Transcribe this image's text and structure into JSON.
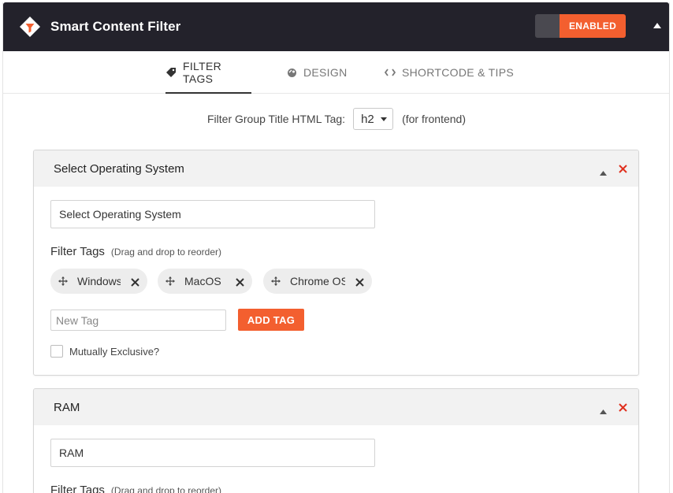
{
  "header": {
    "title": "Smart Content Filter",
    "toggle_label": "ENABLED",
    "accent_color": "#f35f2f",
    "bg_color": "#23222b"
  },
  "tabs": [
    {
      "label": "FILTER TAGS",
      "icon": "tag-icon",
      "active": true
    },
    {
      "label": "DESIGN",
      "icon": "palette-icon",
      "active": false
    },
    {
      "label": "SHORTCODE & TIPS",
      "icon": "code-icon",
      "active": false
    }
  ],
  "title_tag": {
    "label": "Filter Group Title HTML Tag:",
    "value": "h2",
    "hint": "(for frontend)"
  },
  "groups": [
    {
      "title": "Select Operating System",
      "input_value": "Select Operating System",
      "filter_tags_label": "Filter Tags",
      "filter_tags_hint": "(Drag and drop to reorder)",
      "tags": [
        "Windows",
        "MacOS",
        "Chrome OS"
      ],
      "new_tag_placeholder": "New Tag",
      "add_tag_label": "ADD TAG",
      "mutually_exclusive_label": "Mutually Exclusive?"
    },
    {
      "title": "RAM",
      "input_value": "RAM",
      "filter_tags_label": "Filter Tags",
      "filter_tags_hint": "(Drag and drop to reorder)"
    }
  ]
}
